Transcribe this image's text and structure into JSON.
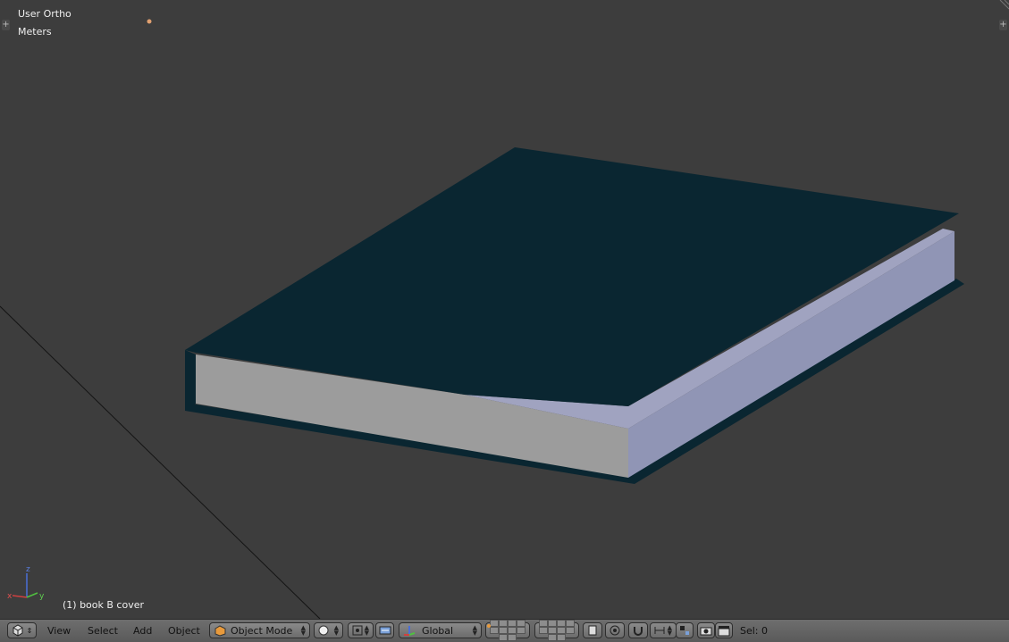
{
  "viewport": {
    "view_name": "User Ortho",
    "units": "Meters",
    "active_object": "(1) book B cover",
    "axes": {
      "x": "x",
      "y": "y",
      "z": "z"
    }
  },
  "header": {
    "menus": [
      "View",
      "Select",
      "Add",
      "Object"
    ],
    "mode": "Object Mode",
    "orientation": "Global",
    "sel_status": "Sel: 0"
  },
  "colors": {
    "background": "#3d3d3d",
    "book_cover": "#0a2631",
    "pages_front": "#9c9c9c",
    "pages_side": "#9095b5"
  }
}
